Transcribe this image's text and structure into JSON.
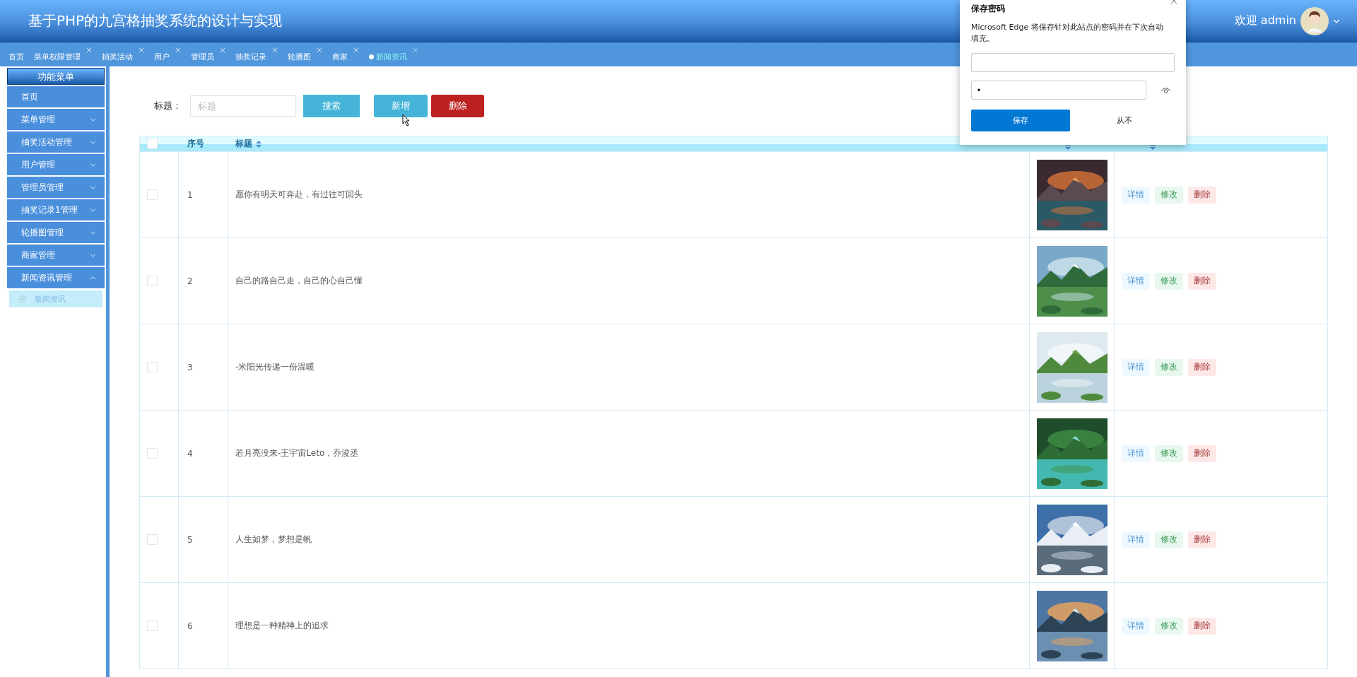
{
  "header": {
    "title": "基于PHP的九宫格抽奖系统的设计与实现",
    "welcome": "欢迎 admin"
  },
  "tabs": [
    {
      "label": "首页",
      "selected": false,
      "closable": false
    },
    {
      "label": "菜单权限管理",
      "selected": false,
      "closable": true
    },
    {
      "label": "抽奖活动",
      "selected": false,
      "closable": true
    },
    {
      "label": "用户",
      "selected": false,
      "closable": true
    },
    {
      "label": "管理员",
      "selected": false,
      "closable": true
    },
    {
      "label": "抽奖记录",
      "selected": false,
      "closable": true
    },
    {
      "label": "轮播图",
      "selected": false,
      "closable": true
    },
    {
      "label": "商家",
      "selected": false,
      "closable": true
    },
    {
      "label": "新闻资讯",
      "selected": true,
      "closable": true
    }
  ],
  "sidebar": {
    "title": "功能菜单",
    "items": [
      {
        "label": "首页",
        "kind": "link"
      },
      {
        "label": "菜单管理",
        "kind": "group",
        "expanded": false
      },
      {
        "label": "抽奖活动管理",
        "kind": "group",
        "expanded": false
      },
      {
        "label": "用户管理",
        "kind": "group",
        "expanded": false
      },
      {
        "label": "管理员管理",
        "kind": "group",
        "expanded": false
      },
      {
        "label": "抽奖记录1管理",
        "kind": "group",
        "expanded": false
      },
      {
        "label": "轮播图管理",
        "kind": "group",
        "expanded": false
      },
      {
        "label": "商家管理",
        "kind": "group",
        "expanded": false
      },
      {
        "label": "新闻资讯管理",
        "kind": "group",
        "expanded": true,
        "children": [
          {
            "label": "新闻资讯",
            "selected": true
          }
        ]
      }
    ]
  },
  "toolbar": {
    "label": "标题：",
    "placeholder": "标题",
    "search": "搜索",
    "add": "新增",
    "delete": "删除"
  },
  "table": {
    "select_all": false,
    "columns": [
      {
        "label": "序号",
        "sortable": false
      },
      {
        "label": "标题",
        "sortable": true
      },
      {
        "sortable": true
      },
      {
        "sortable": true
      }
    ],
    "rows": [
      {
        "checked": false,
        "index": "1",
        "title": "愿你有明天可奔赴，有过往可回头",
        "actions": [
          {
            "label": "详情",
            "kind": "detail"
          },
          {
            "label": "修改",
            "kind": "edit"
          },
          {
            "label": "删除",
            "kind": "delete"
          }
        ]
      },
      {
        "checked": false,
        "index": "2",
        "title": "自己的路自己走，自己的心自己懂",
        "actions": [
          {
            "label": "详情",
            "kind": "detail"
          },
          {
            "label": "修改",
            "kind": "edit"
          },
          {
            "label": "删除",
            "kind": "delete"
          }
        ]
      },
      {
        "checked": false,
        "index": "3",
        "title": "-米阳光传递一份温暖",
        "actions": [
          {
            "label": "详情",
            "kind": "detail"
          },
          {
            "label": "修改",
            "kind": "edit"
          },
          {
            "label": "删除",
            "kind": "delete"
          }
        ]
      },
      {
        "checked": false,
        "index": "4",
        "title": "若月亮没来-王宇宙Leto，乔浚丞",
        "actions": [
          {
            "label": "详情",
            "kind": "detail"
          },
          {
            "label": "修改",
            "kind": "edit"
          },
          {
            "label": "删除",
            "kind": "delete"
          }
        ]
      },
      {
        "checked": false,
        "index": "5",
        "title": "人生如梦，梦想是帆",
        "actions": [
          {
            "label": "详情",
            "kind": "detail"
          },
          {
            "label": "修改",
            "kind": "edit"
          },
          {
            "label": "删除",
            "kind": "delete"
          }
        ]
      },
      {
        "checked": false,
        "index": "6",
        "title": "理想是一种精神上的追求",
        "actions": [
          {
            "label": "详情",
            "kind": "detail"
          },
          {
            "label": "修改",
            "kind": "edit"
          },
          {
            "label": "删除",
            "kind": "delete"
          }
        ]
      }
    ]
  },
  "password_popup": {
    "title": "保存密码",
    "message": "Microsoft Edge 将保存针对此站点的密码并在下次自动填充。",
    "password": "•",
    "save": "保存",
    "never": "从不"
  }
}
